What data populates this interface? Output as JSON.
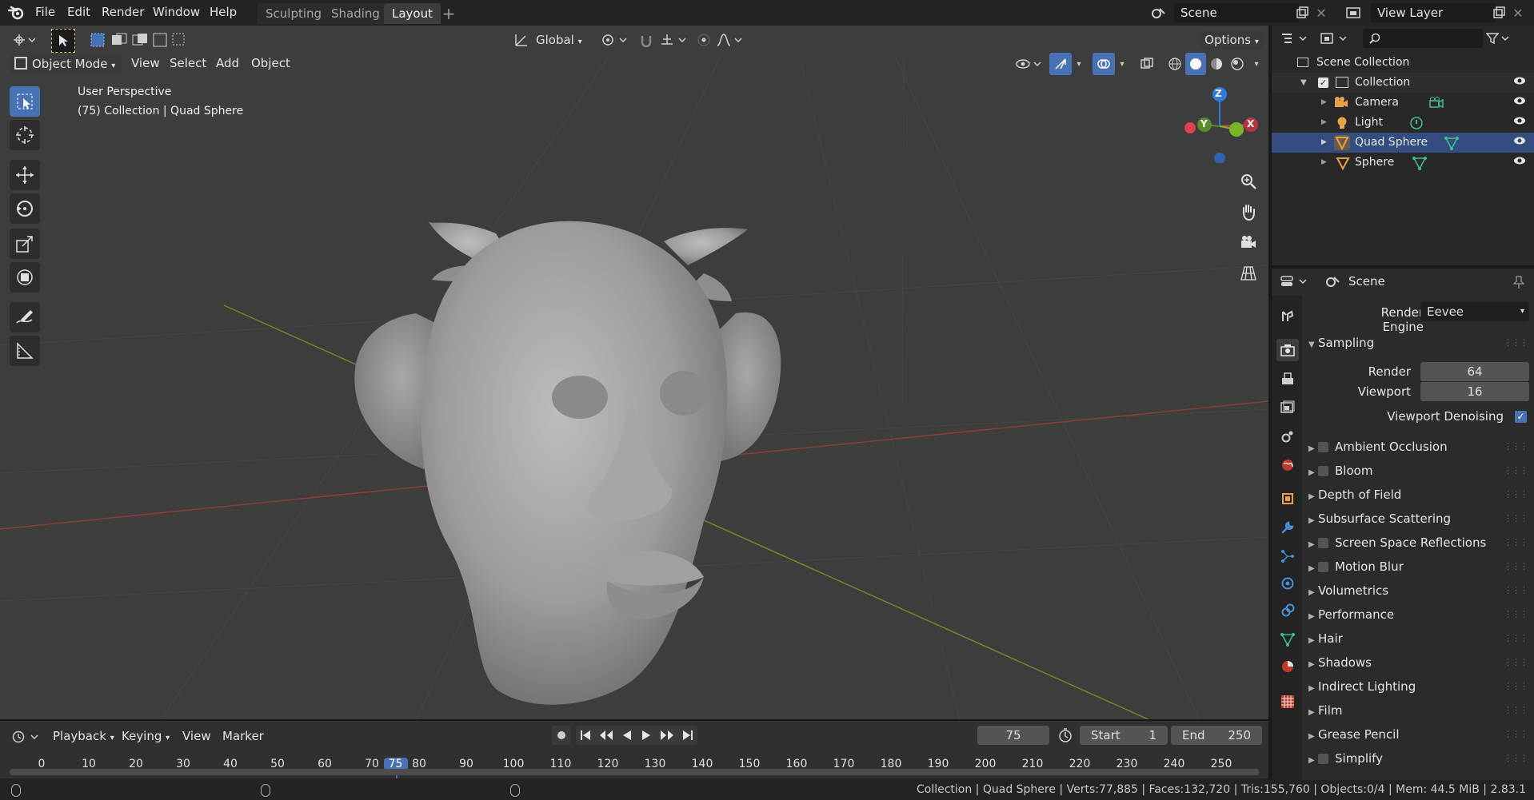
{
  "app": {
    "accent": "#4772b3"
  },
  "menubar": {
    "items": [
      "File",
      "Edit",
      "Render",
      "Window",
      "Help"
    ]
  },
  "workspaces": {
    "tabs": [
      "Sculpting",
      "Shading",
      "Layout"
    ],
    "active": "Layout",
    "add_icon": "plus-icon"
  },
  "scene_selector": {
    "label": "Scene"
  },
  "view_layer": {
    "label": "View Layer"
  },
  "toolbar_top": {
    "orientation": "Global",
    "options": "Options"
  },
  "viewport_header": {
    "mode": "Object Mode",
    "menus": [
      "View",
      "Select",
      "Add",
      "Object"
    ]
  },
  "viewport": {
    "perspective": "User Perspective",
    "info": "(75) Collection | Quad Sphere"
  },
  "gizmo": {
    "x": "X",
    "y": "Y",
    "z": "Z"
  },
  "outliner": {
    "root": "Scene Collection",
    "collection": "Collection",
    "items": [
      {
        "name": "Camera",
        "icon": "camera-icon",
        "color": "#e8a04a"
      },
      {
        "name": "Light",
        "icon": "light-icon",
        "color": "#e8a04a"
      },
      {
        "name": "Quad Sphere",
        "icon": "mesh-icon",
        "color": "#e8a04a"
      },
      {
        "name": "Sphere",
        "icon": "mesh-icon",
        "color": "#e8a04a"
      }
    ]
  },
  "properties": {
    "context": "Scene",
    "render_engine_label": "Render Engine",
    "render_engine": "Eevee",
    "sampling": {
      "title": "Sampling",
      "render_label": "Render",
      "render": "64",
      "viewport_label": "Viewport",
      "viewport": "16",
      "denoise_label": "Viewport Denoising"
    },
    "panels": [
      {
        "label": "Ambient Occlusion",
        "checkbox": true
      },
      {
        "label": "Bloom",
        "checkbox": true
      },
      {
        "label": "Depth of Field",
        "checkbox": false
      },
      {
        "label": "Subsurface Scattering",
        "checkbox": false
      },
      {
        "label": "Screen Space Reflections",
        "checkbox": true
      },
      {
        "label": "Motion Blur",
        "checkbox": true
      },
      {
        "label": "Volumetrics",
        "checkbox": false
      },
      {
        "label": "Performance",
        "checkbox": false
      },
      {
        "label": "Hair",
        "checkbox": false
      },
      {
        "label": "Shadows",
        "checkbox": false
      },
      {
        "label": "Indirect Lighting",
        "checkbox": false
      },
      {
        "label": "Film",
        "checkbox": false
      },
      {
        "label": "Grease Pencil",
        "checkbox": false
      },
      {
        "label": "Simplify",
        "checkbox": true
      }
    ]
  },
  "timeline": {
    "menus": [
      "Playback",
      "Keying",
      "View",
      "Marker"
    ],
    "current_frame": "75",
    "start_label": "Start",
    "start": "1",
    "end_label": "End",
    "end": "250",
    "ticks": [
      "0",
      "10",
      "20",
      "30",
      "40",
      "50",
      "60",
      "70",
      "75",
      "80",
      "90",
      "100",
      "110",
      "120",
      "130",
      "140",
      "150",
      "160",
      "170",
      "180",
      "190",
      "200",
      "210",
      "220",
      "230",
      "240",
      "250"
    ]
  },
  "statusbar": {
    "text": "Collection | Quad Sphere | Verts:77,885 | Faces:132,720 | Tris:155,760 | Objects:0/4 | Mem: 44.5 MiB | 2.83.1"
  }
}
